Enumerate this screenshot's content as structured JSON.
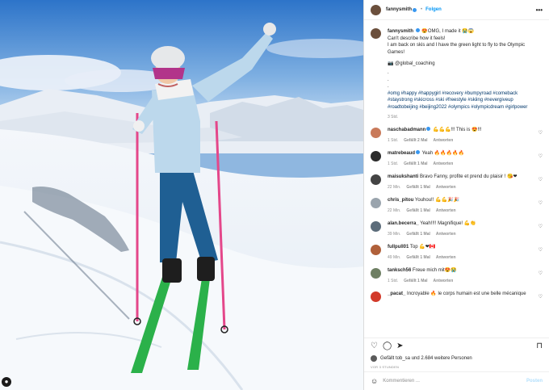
{
  "post": {
    "username": "fannysmith",
    "follow_label": "Folgen",
    "more_label": "•••",
    "caption_username": "fannysmith",
    "caption_lines": [
      "😍OMG, I made it 😭😱",
      "Can't describe how it feels!",
      "I am back on skis and I have the green light to fly to the Olympic Games!"
    ],
    "coach_line": "📷 @global_coaching",
    "dots": [
      ".",
      ".",
      "."
    ],
    "hashtags": "#omg #happy #happygirl #recovery #bumpyroad #comeback #staystrong #skicross #ski #freestyle #skiing #nevergiveup #roadtobeijing #beijing2022 #olympics #olympicdream #girlpower",
    "time": "3 Std."
  },
  "comments": [
    {
      "user": "naschabadmann",
      "verified": true,
      "text": "💪💪💪!!! This is 😍!!!",
      "time": "1 Std.",
      "likes": "Gefällt 2 Mal",
      "reply": "Antworten",
      "color": "#c97a5a"
    },
    {
      "user": "matrebeaud",
      "verified": true,
      "text": "Yeah 🔥🔥🔥🔥🔥",
      "time": "1 Std.",
      "likes": "Gefällt 1 Mal",
      "reply": "Antworten",
      "color": "#2b2b2b"
    },
    {
      "user": "maisukshanti",
      "verified": false,
      "text": "Bravo Fanny, profite et prend du plaisir ! 😘❤",
      "time": "22 Min.",
      "likes": "Gefällt 1 Mal",
      "reply": "Antworten",
      "color": "#444444"
    },
    {
      "user": "chris_pitou",
      "verified": false,
      "text": "Youhou!! 💪💪🎉🎉",
      "time": "22 Min.",
      "likes": "Gefällt 1 Mal",
      "reply": "Antworten",
      "color": "#9aa4ad"
    },
    {
      "user": "alan.becerra_",
      "verified": false,
      "text": "Yeah!!!! Magnifique! 💪👏",
      "time": "39 Min.",
      "likes": "Gefällt 1 Mal",
      "reply": "Antworten",
      "color": "#5c6c7a"
    },
    {
      "user": "fullpull01",
      "verified": false,
      "text": "Top 💪❤🇨🇦",
      "time": "49 Min.",
      "likes": "Gefällt 1 Mal",
      "reply": "Antworten",
      "color": "#b0603a"
    },
    {
      "user": "tanksch56",
      "verified": false,
      "text": "Freue mich mit😍😭",
      "time": "1 Std.",
      "likes": "Gefällt 1 Mal",
      "reply": "Antworten",
      "color": "#6e7f63"
    },
    {
      "user": "_pacat_",
      "verified": false,
      "text": "Incroyable 🔥 le corps humain est une belle mécanique",
      "time": "",
      "likes": "",
      "reply": "",
      "color": "#d23a2a"
    }
  ],
  "likes_text": "Gefällt tob_sa und 2.684 weitere Personen",
  "date_text": "VOR 3 STUNDEN",
  "composer": {
    "placeholder": "Kommentieren ...",
    "post_label": "Posten"
  },
  "icons": {
    "heart": "heart-icon",
    "comment": "comment-icon",
    "share": "share-icon",
    "save": "bookmark-icon",
    "emoji": "emoji-icon"
  }
}
